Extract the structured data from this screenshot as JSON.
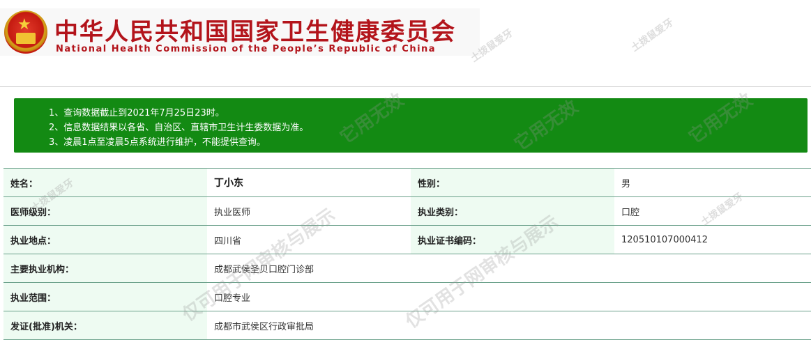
{
  "header": {
    "title_cn": "中华人民共和国国家卫生健康委员会",
    "title_en": "National Health Commission of the People’s Republic of China"
  },
  "notice": {
    "lines": [
      "1、查询数据截止到2021年7月25日23时。",
      "2、信息数据结果以各省、自治区、直辖市卫生计生委数据为准。",
      "3、凌晨1点至凌晨5点系统进行维护，不能提供查询。"
    ],
    "background_color": "#138a13"
  },
  "record": {
    "name_label": "姓名：",
    "name_value": "丁小东",
    "gender_label": "性别：",
    "gender_value": "男",
    "level_label": "医师级别：",
    "level_value": "执业医师",
    "category_label": "执业类别：",
    "category_value": "口腔",
    "location_label": "执业地点：",
    "location_value": "四川省",
    "cert_label": "执业证书编码：",
    "cert_value": "120510107000412",
    "institution_label": "主要执业机构：",
    "institution_value": "成都武侯圣贝口腔门诊部",
    "scope_label": "执业范围：",
    "scope_value": "口腔专业",
    "authority_label": "发证(批准)机关：",
    "authority_value": "成都市武侯区行政审批局"
  },
  "watermarks": {
    "small": "土拨鼠爱牙",
    "large_1": "它用无效",
    "large_2": "仅可用于网审核与展示"
  }
}
